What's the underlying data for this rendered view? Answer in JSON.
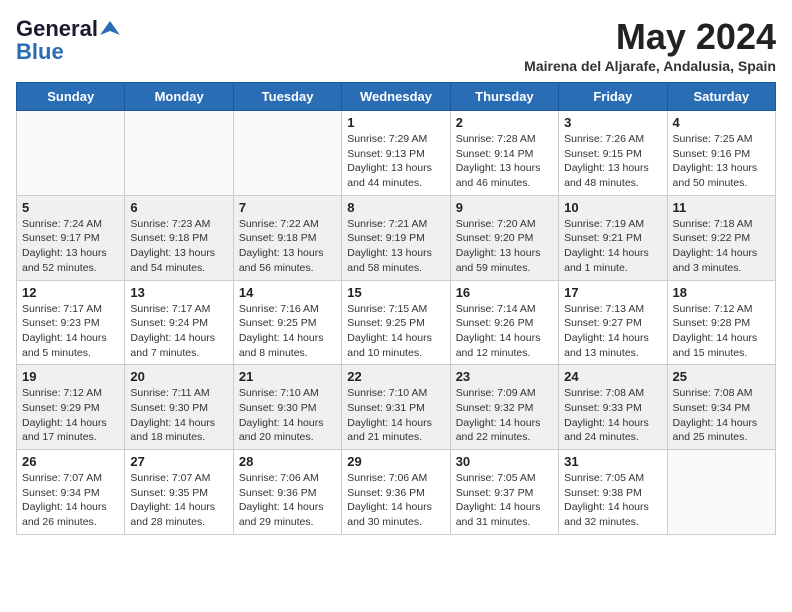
{
  "header": {
    "logo_line1": "General",
    "logo_line2": "Blue",
    "title": "May 2024",
    "subtitle": "Mairena del Aljarafe, Andalusia, Spain"
  },
  "weekdays": [
    "Sunday",
    "Monday",
    "Tuesday",
    "Wednesday",
    "Thursday",
    "Friday",
    "Saturday"
  ],
  "weeks": [
    [
      {
        "day": "",
        "info": ""
      },
      {
        "day": "",
        "info": ""
      },
      {
        "day": "",
        "info": ""
      },
      {
        "day": "1",
        "info": "Sunrise: 7:29 AM\nSunset: 9:13 PM\nDaylight: 13 hours\nand 44 minutes."
      },
      {
        "day": "2",
        "info": "Sunrise: 7:28 AM\nSunset: 9:14 PM\nDaylight: 13 hours\nand 46 minutes."
      },
      {
        "day": "3",
        "info": "Sunrise: 7:26 AM\nSunset: 9:15 PM\nDaylight: 13 hours\nand 48 minutes."
      },
      {
        "day": "4",
        "info": "Sunrise: 7:25 AM\nSunset: 9:16 PM\nDaylight: 13 hours\nand 50 minutes."
      }
    ],
    [
      {
        "day": "5",
        "info": "Sunrise: 7:24 AM\nSunset: 9:17 PM\nDaylight: 13 hours\nand 52 minutes."
      },
      {
        "day": "6",
        "info": "Sunrise: 7:23 AM\nSunset: 9:18 PM\nDaylight: 13 hours\nand 54 minutes."
      },
      {
        "day": "7",
        "info": "Sunrise: 7:22 AM\nSunset: 9:18 PM\nDaylight: 13 hours\nand 56 minutes."
      },
      {
        "day": "8",
        "info": "Sunrise: 7:21 AM\nSunset: 9:19 PM\nDaylight: 13 hours\nand 58 minutes."
      },
      {
        "day": "9",
        "info": "Sunrise: 7:20 AM\nSunset: 9:20 PM\nDaylight: 13 hours\nand 59 minutes."
      },
      {
        "day": "10",
        "info": "Sunrise: 7:19 AM\nSunset: 9:21 PM\nDaylight: 14 hours\nand 1 minute."
      },
      {
        "day": "11",
        "info": "Sunrise: 7:18 AM\nSunset: 9:22 PM\nDaylight: 14 hours\nand 3 minutes."
      }
    ],
    [
      {
        "day": "12",
        "info": "Sunrise: 7:17 AM\nSunset: 9:23 PM\nDaylight: 14 hours\nand 5 minutes."
      },
      {
        "day": "13",
        "info": "Sunrise: 7:17 AM\nSunset: 9:24 PM\nDaylight: 14 hours\nand 7 minutes."
      },
      {
        "day": "14",
        "info": "Sunrise: 7:16 AM\nSunset: 9:25 PM\nDaylight: 14 hours\nand 8 minutes."
      },
      {
        "day": "15",
        "info": "Sunrise: 7:15 AM\nSunset: 9:25 PM\nDaylight: 14 hours\nand 10 minutes."
      },
      {
        "day": "16",
        "info": "Sunrise: 7:14 AM\nSunset: 9:26 PM\nDaylight: 14 hours\nand 12 minutes."
      },
      {
        "day": "17",
        "info": "Sunrise: 7:13 AM\nSunset: 9:27 PM\nDaylight: 14 hours\nand 13 minutes."
      },
      {
        "day": "18",
        "info": "Sunrise: 7:12 AM\nSunset: 9:28 PM\nDaylight: 14 hours\nand 15 minutes."
      }
    ],
    [
      {
        "day": "19",
        "info": "Sunrise: 7:12 AM\nSunset: 9:29 PM\nDaylight: 14 hours\nand 17 minutes."
      },
      {
        "day": "20",
        "info": "Sunrise: 7:11 AM\nSunset: 9:30 PM\nDaylight: 14 hours\nand 18 minutes."
      },
      {
        "day": "21",
        "info": "Sunrise: 7:10 AM\nSunset: 9:30 PM\nDaylight: 14 hours\nand 20 minutes."
      },
      {
        "day": "22",
        "info": "Sunrise: 7:10 AM\nSunset: 9:31 PM\nDaylight: 14 hours\nand 21 minutes."
      },
      {
        "day": "23",
        "info": "Sunrise: 7:09 AM\nSunset: 9:32 PM\nDaylight: 14 hours\nand 22 minutes."
      },
      {
        "day": "24",
        "info": "Sunrise: 7:08 AM\nSunset: 9:33 PM\nDaylight: 14 hours\nand 24 minutes."
      },
      {
        "day": "25",
        "info": "Sunrise: 7:08 AM\nSunset: 9:34 PM\nDaylight: 14 hours\nand 25 minutes."
      }
    ],
    [
      {
        "day": "26",
        "info": "Sunrise: 7:07 AM\nSunset: 9:34 PM\nDaylight: 14 hours\nand 26 minutes."
      },
      {
        "day": "27",
        "info": "Sunrise: 7:07 AM\nSunset: 9:35 PM\nDaylight: 14 hours\nand 28 minutes."
      },
      {
        "day": "28",
        "info": "Sunrise: 7:06 AM\nSunset: 9:36 PM\nDaylight: 14 hours\nand 29 minutes."
      },
      {
        "day": "29",
        "info": "Sunrise: 7:06 AM\nSunset: 9:36 PM\nDaylight: 14 hours\nand 30 minutes."
      },
      {
        "day": "30",
        "info": "Sunrise: 7:05 AM\nSunset: 9:37 PM\nDaylight: 14 hours\nand 31 minutes."
      },
      {
        "day": "31",
        "info": "Sunrise: 7:05 AM\nSunset: 9:38 PM\nDaylight: 14 hours\nand 32 minutes."
      },
      {
        "day": "",
        "info": ""
      }
    ]
  ]
}
